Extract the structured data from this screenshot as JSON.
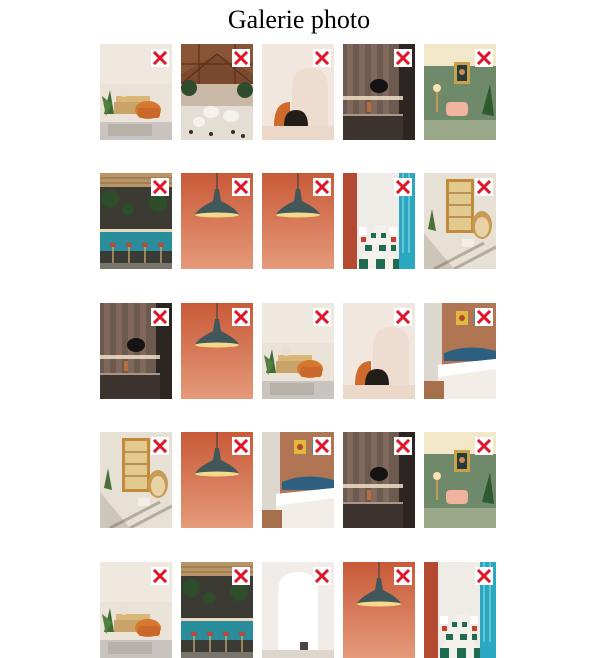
{
  "page": {
    "title": "Galerie photo"
  },
  "gallery": {
    "delete_icon": "close-icon",
    "delete_color": "#e0162b",
    "rows": [
      [
        "living-room-orange-armchair",
        "greenhouse-restaurant",
        "beige-arches-wall",
        "dark-kitchen-pendant",
        "green-wall-portrait-lounge"
      ],
      [
        "bar-teal-stools",
        "pendant-lamp-orange-wall",
        "pendant-lamp-orange-wall",
        "long-dining-hall-checkered",
        "lounge-rattan-chair"
      ],
      [
        "dark-kitchen-pendant",
        "pendant-lamp-orange-wall",
        "living-room-orange-armchair",
        "beige-arches-wall",
        "bedroom-blue-headboard"
      ],
      [
        "lounge-rattan-chair",
        "pendant-lamp-orange-wall",
        "bedroom-blue-headboard",
        "dark-kitchen-pendant",
        "green-wall-portrait-lounge"
      ],
      [
        "living-room-orange-armchair",
        "bar-teal-stools",
        "white-arch-room",
        "pendant-lamp-orange-wall",
        "long-dining-hall-checkered"
      ]
    ]
  }
}
